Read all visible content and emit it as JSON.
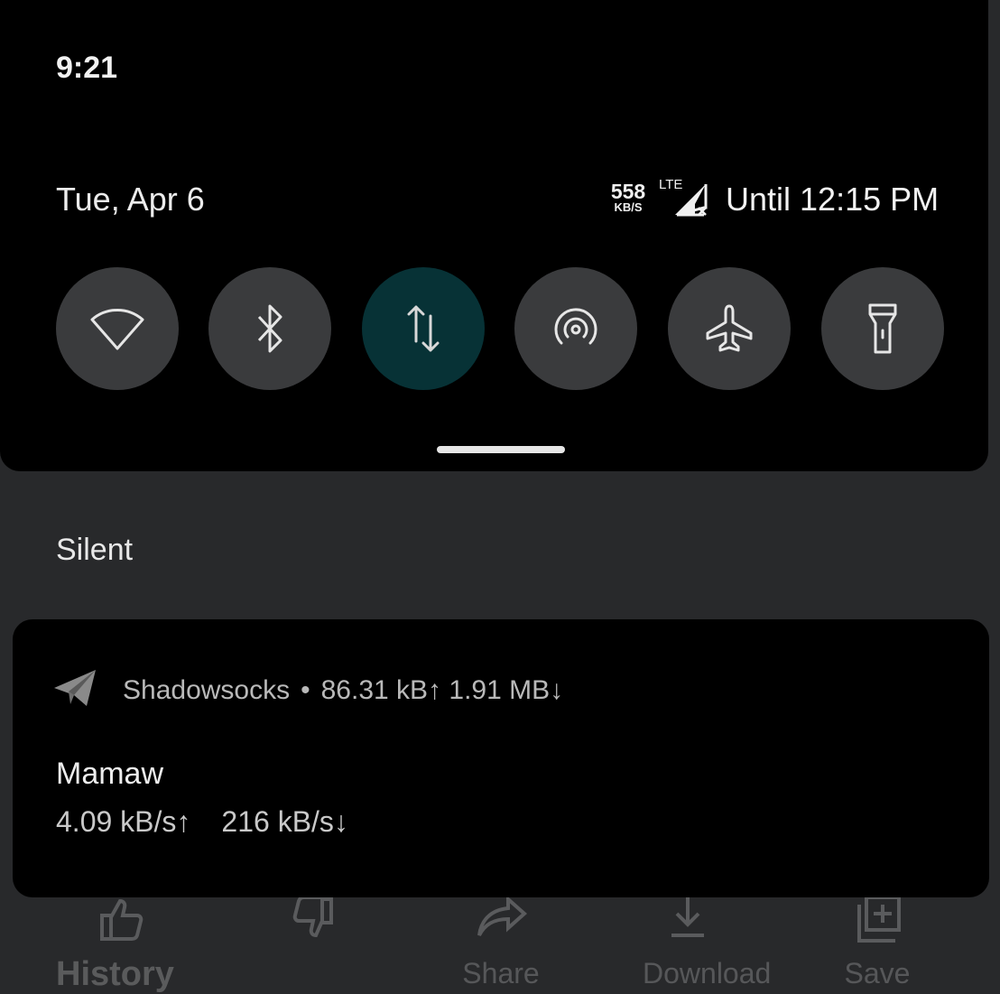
{
  "status_bar": {
    "time": "9:21"
  },
  "quick_settings": {
    "date": "Tue, Apr 6",
    "network_speed": {
      "value": "558",
      "unit": "KB/S"
    },
    "network_type": "LTE",
    "until": "Until 12:15 PM",
    "tiles": [
      {
        "icon": "wifi-icon",
        "active": false
      },
      {
        "icon": "bluetooth-icon",
        "active": false
      },
      {
        "icon": "mobile-data-icon",
        "active": true
      },
      {
        "icon": "hotspot-icon",
        "active": false
      },
      {
        "icon": "airplane-icon",
        "active": false
      },
      {
        "icon": "flashlight-icon",
        "active": false
      }
    ]
  },
  "section": {
    "title": "Silent"
  },
  "notification": {
    "app_icon": "paper-plane-icon",
    "app_name": "Shadowsocks",
    "separator": "•",
    "summary": "86.31 kB↑ 1.91 MB↓",
    "title": "Mamaw",
    "upload_rate": "4.09 kB/s↑",
    "download_rate": "216 kB/s↓"
  },
  "background_app": {
    "actions": [
      {
        "icon": "thumbs-up-icon",
        "label": ""
      },
      {
        "icon": "thumbs-down-icon",
        "label": ""
      },
      {
        "icon": "share-icon",
        "label": "Share"
      },
      {
        "icon": "download-icon",
        "label": "Download"
      },
      {
        "icon": "save-icon",
        "label": "Save"
      }
    ],
    "history_label": "History"
  },
  "colors": {
    "panel": "#000000",
    "backdrop": "#28292b",
    "tile": "#3a3b3d",
    "tile_active": "#073236",
    "icon": "#e6e6e6"
  }
}
